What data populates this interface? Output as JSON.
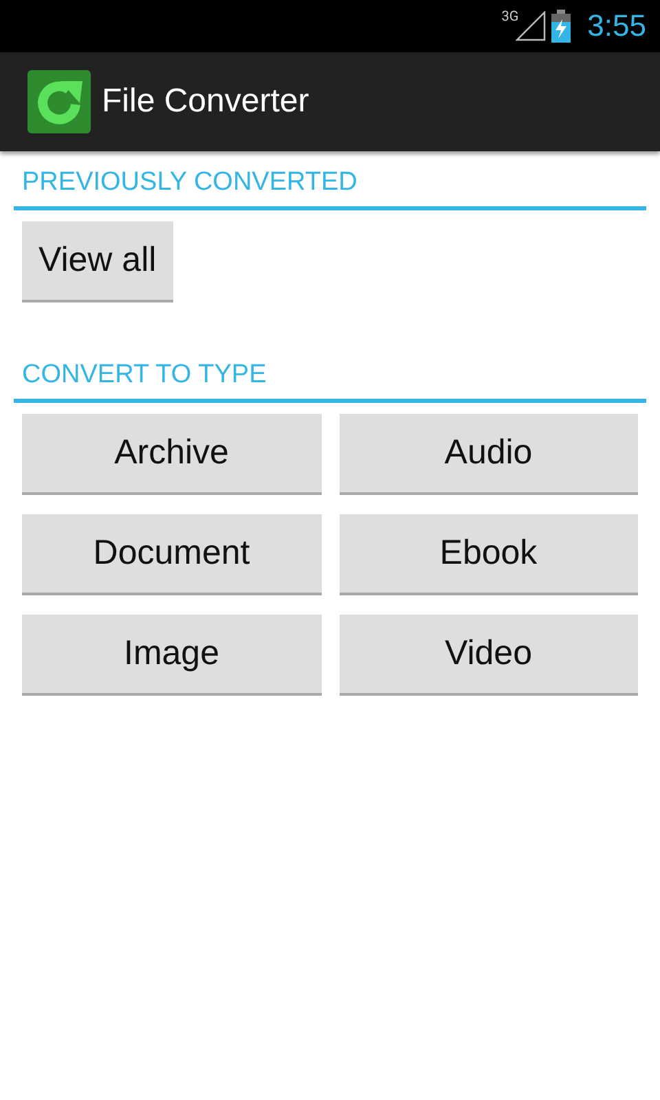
{
  "status_bar": {
    "network": "3G",
    "time": "3:55"
  },
  "app_bar": {
    "title": "File Converter"
  },
  "sections": [
    {
      "title": "PREVIOUSLY CONVERTED",
      "kind": "single",
      "buttons": [
        "View all"
      ]
    },
    {
      "title": "CONVERT TO TYPE",
      "kind": "grid",
      "buttons": [
        "Archive",
        "Audio",
        "Document",
        "Ebook",
        "Image",
        "Video"
      ]
    }
  ]
}
